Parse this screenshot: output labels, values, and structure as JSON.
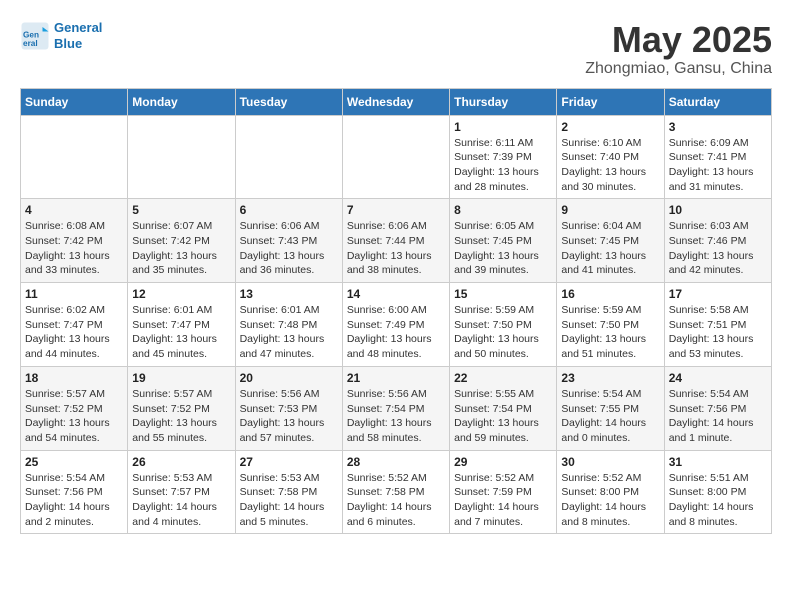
{
  "logo": {
    "line1": "General",
    "line2": "Blue"
  },
  "title": "May 2025",
  "subtitle": "Zhongmiao, Gansu, China",
  "days_of_week": [
    "Sunday",
    "Monday",
    "Tuesday",
    "Wednesday",
    "Thursday",
    "Friday",
    "Saturday"
  ],
  "weeks": [
    [
      {
        "day": "",
        "info": ""
      },
      {
        "day": "",
        "info": ""
      },
      {
        "day": "",
        "info": ""
      },
      {
        "day": "",
        "info": ""
      },
      {
        "day": "1",
        "info": "Sunrise: 6:11 AM\nSunset: 7:39 PM\nDaylight: 13 hours\nand 28 minutes."
      },
      {
        "day": "2",
        "info": "Sunrise: 6:10 AM\nSunset: 7:40 PM\nDaylight: 13 hours\nand 30 minutes."
      },
      {
        "day": "3",
        "info": "Sunrise: 6:09 AM\nSunset: 7:41 PM\nDaylight: 13 hours\nand 31 minutes."
      }
    ],
    [
      {
        "day": "4",
        "info": "Sunrise: 6:08 AM\nSunset: 7:42 PM\nDaylight: 13 hours\nand 33 minutes."
      },
      {
        "day": "5",
        "info": "Sunrise: 6:07 AM\nSunset: 7:42 PM\nDaylight: 13 hours\nand 35 minutes."
      },
      {
        "day": "6",
        "info": "Sunrise: 6:06 AM\nSunset: 7:43 PM\nDaylight: 13 hours\nand 36 minutes."
      },
      {
        "day": "7",
        "info": "Sunrise: 6:06 AM\nSunset: 7:44 PM\nDaylight: 13 hours\nand 38 minutes."
      },
      {
        "day": "8",
        "info": "Sunrise: 6:05 AM\nSunset: 7:45 PM\nDaylight: 13 hours\nand 39 minutes."
      },
      {
        "day": "9",
        "info": "Sunrise: 6:04 AM\nSunset: 7:45 PM\nDaylight: 13 hours\nand 41 minutes."
      },
      {
        "day": "10",
        "info": "Sunrise: 6:03 AM\nSunset: 7:46 PM\nDaylight: 13 hours\nand 42 minutes."
      }
    ],
    [
      {
        "day": "11",
        "info": "Sunrise: 6:02 AM\nSunset: 7:47 PM\nDaylight: 13 hours\nand 44 minutes."
      },
      {
        "day": "12",
        "info": "Sunrise: 6:01 AM\nSunset: 7:47 PM\nDaylight: 13 hours\nand 45 minutes."
      },
      {
        "day": "13",
        "info": "Sunrise: 6:01 AM\nSunset: 7:48 PM\nDaylight: 13 hours\nand 47 minutes."
      },
      {
        "day": "14",
        "info": "Sunrise: 6:00 AM\nSunset: 7:49 PM\nDaylight: 13 hours\nand 48 minutes."
      },
      {
        "day": "15",
        "info": "Sunrise: 5:59 AM\nSunset: 7:50 PM\nDaylight: 13 hours\nand 50 minutes."
      },
      {
        "day": "16",
        "info": "Sunrise: 5:59 AM\nSunset: 7:50 PM\nDaylight: 13 hours\nand 51 minutes."
      },
      {
        "day": "17",
        "info": "Sunrise: 5:58 AM\nSunset: 7:51 PM\nDaylight: 13 hours\nand 53 minutes."
      }
    ],
    [
      {
        "day": "18",
        "info": "Sunrise: 5:57 AM\nSunset: 7:52 PM\nDaylight: 13 hours\nand 54 minutes."
      },
      {
        "day": "19",
        "info": "Sunrise: 5:57 AM\nSunset: 7:52 PM\nDaylight: 13 hours\nand 55 minutes."
      },
      {
        "day": "20",
        "info": "Sunrise: 5:56 AM\nSunset: 7:53 PM\nDaylight: 13 hours\nand 57 minutes."
      },
      {
        "day": "21",
        "info": "Sunrise: 5:56 AM\nSunset: 7:54 PM\nDaylight: 13 hours\nand 58 minutes."
      },
      {
        "day": "22",
        "info": "Sunrise: 5:55 AM\nSunset: 7:54 PM\nDaylight: 13 hours\nand 59 minutes."
      },
      {
        "day": "23",
        "info": "Sunrise: 5:54 AM\nSunset: 7:55 PM\nDaylight: 14 hours\nand 0 minutes."
      },
      {
        "day": "24",
        "info": "Sunrise: 5:54 AM\nSunset: 7:56 PM\nDaylight: 14 hours\nand 1 minute."
      }
    ],
    [
      {
        "day": "25",
        "info": "Sunrise: 5:54 AM\nSunset: 7:56 PM\nDaylight: 14 hours\nand 2 minutes."
      },
      {
        "day": "26",
        "info": "Sunrise: 5:53 AM\nSunset: 7:57 PM\nDaylight: 14 hours\nand 4 minutes."
      },
      {
        "day": "27",
        "info": "Sunrise: 5:53 AM\nSunset: 7:58 PM\nDaylight: 14 hours\nand 5 minutes."
      },
      {
        "day": "28",
        "info": "Sunrise: 5:52 AM\nSunset: 7:58 PM\nDaylight: 14 hours\nand 6 minutes."
      },
      {
        "day": "29",
        "info": "Sunrise: 5:52 AM\nSunset: 7:59 PM\nDaylight: 14 hours\nand 7 minutes."
      },
      {
        "day": "30",
        "info": "Sunrise: 5:52 AM\nSunset: 8:00 PM\nDaylight: 14 hours\nand 8 minutes."
      },
      {
        "day": "31",
        "info": "Sunrise: 5:51 AM\nSunset: 8:00 PM\nDaylight: 14 hours\nand 8 minutes."
      }
    ]
  ]
}
